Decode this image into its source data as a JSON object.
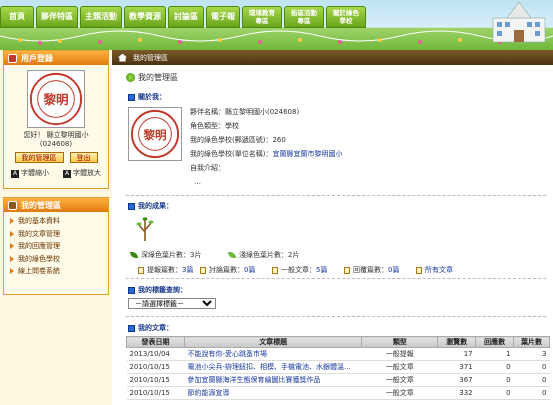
{
  "nav": {
    "tabs": [
      "首頁",
      "夥伴特區",
      "主題活動",
      "教學資源",
      "討論區",
      "電子報",
      "環境教育專區",
      "街區活動專區",
      "關於綠色學校"
    ]
  },
  "login": {
    "title": "用戶登錄",
    "greeting": "您好！ 縣立黎明國小",
    "code": "(024608)",
    "my_area_btn": "我的管理區",
    "logout_btn": "登出",
    "font_small": "字體縮小",
    "font_large": "字體放大",
    "font_small_icon": "A",
    "font_large_icon": "A"
  },
  "manager": {
    "title": "我的管理區",
    "items": [
      "我的基本資料",
      "我的文章管理",
      "我的回應管理",
      "我的綠色學校",
      "線上問卷系統"
    ]
  },
  "breadcrumb": "我的管理區",
  "page_title": "我的管理區",
  "about": {
    "heading": "關於我：",
    "name_label": "夥伴名稱：",
    "name": "縣立黎明國小(024608)",
    "role_label": "角色類型：",
    "role": "學校",
    "school_label": "我的綠色學校(郵遞區號)：",
    "school_zip": "260",
    "unit_label": "我的綠色學校(單位名稱)：",
    "unit": "宜蘭縣宜蘭市黎明國小",
    "intro_label": "自我介紹：",
    "intro": "…"
  },
  "achievements": {
    "heading": "我的成果：",
    "deep_label": "深綠色葉片數：",
    "deep_value": "3片",
    "light_label": "淺綠色葉片數：",
    "light_value": "2片",
    "reports_label": "提報篇數：",
    "reports_value": "3篇",
    "discussion_label": "討論篇數：",
    "discussion_value": "0篇",
    "general_label": "一般文章：",
    "general_value": "5篇",
    "reply_label": "回覆篇數：",
    "reply_value": "0篇",
    "all_articles": "所有文章"
  },
  "tag_search": {
    "heading": "我的標籤查詢：",
    "select_value": "－請選擇標籤－"
  },
  "articles": {
    "heading": "我的文章：",
    "headers": [
      "發表日期",
      "文章標題",
      "類型",
      "瀏覽數",
      "回應數",
      "葉片數"
    ],
    "rows": [
      {
        "date": "2013/10/04",
        "title": "不能說有你-愛心跳蚤市場",
        "type": "一般提報",
        "views": "17",
        "replies": "1",
        "leaves": "3"
      },
      {
        "date": "2010/10/15",
        "title": "電池小尖兵-辦理鈕扣、相模、手機電池、水銀體溫...",
        "type": "一般文章",
        "views": "371",
        "replies": "0",
        "leaves": "0"
      },
      {
        "date": "2010/10/15",
        "title": "參加宜蘭縣海洋生態保育繪圖比賽獲獎作品",
        "type": "一般文章",
        "views": "367",
        "replies": "0",
        "leaves": "0"
      },
      {
        "date": "2010/10/15",
        "title": "節約能源宣導",
        "type": "一般文章",
        "views": "332",
        "replies": "0",
        "leaves": "0"
      }
    ]
  },
  "colors": {
    "nav_green": "#7ab82a",
    "panel_orange": "#f09020",
    "link_blue": "#1a3aa0",
    "crumb_brown": "#5a3e18"
  }
}
